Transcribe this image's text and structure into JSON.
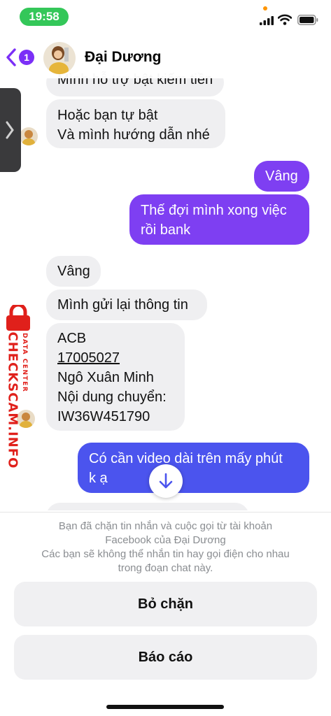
{
  "status_bar": {
    "time": "19:58"
  },
  "header": {
    "unread_count": "1",
    "contact_name": "Đại Dương"
  },
  "messages": [
    {
      "lines": [
        "Mình hỗ trợ bật kiếm tiền"
      ]
    },
    {
      "lines": [
        "Hoặc bạn tự bật",
        "Và mình hướng dẫn nhé"
      ]
    },
    {
      "lines": [
        "Vâng"
      ]
    },
    {
      "lines": [
        "Thế đợi mình xong việc",
        "rồi bank"
      ]
    },
    {
      "lines": [
        "Vâng"
      ]
    },
    {
      "lines": [
        "Mình gửi lại thông tin"
      ]
    },
    {
      "lines": [
        "ACB",
        "17005027",
        "Ngô Xuân Minh",
        "Nội dung chuyển:",
        "IW36W451790"
      ]
    },
    {
      "lines": [
        "Có cần video dài trên mấy phút",
        "k ạ"
      ]
    }
  ],
  "watermark": {
    "main": "CHECKSCAM.INFO",
    "sub": "DATA CENTER"
  },
  "blocked": {
    "line1": "Bạn đã chặn tin nhắn và cuộc gọi từ tài khoản",
    "line2": "Facebook của Đại Dương",
    "line3": "Các bạn sẽ không thể nhắn tin hay gọi điện cho nhau",
    "line4": "trong đoạn chat này.",
    "unblock_label": "Bỏ chặn",
    "report_label": "Báo cáo"
  },
  "colors": {
    "outgoing": "#7e3ff2",
    "outgoing_latest": "#4b54ee",
    "incoming": "#efeff1",
    "accent": "#7b2ff7",
    "time_pill": "#34c759",
    "watermark": "#e0201b"
  }
}
